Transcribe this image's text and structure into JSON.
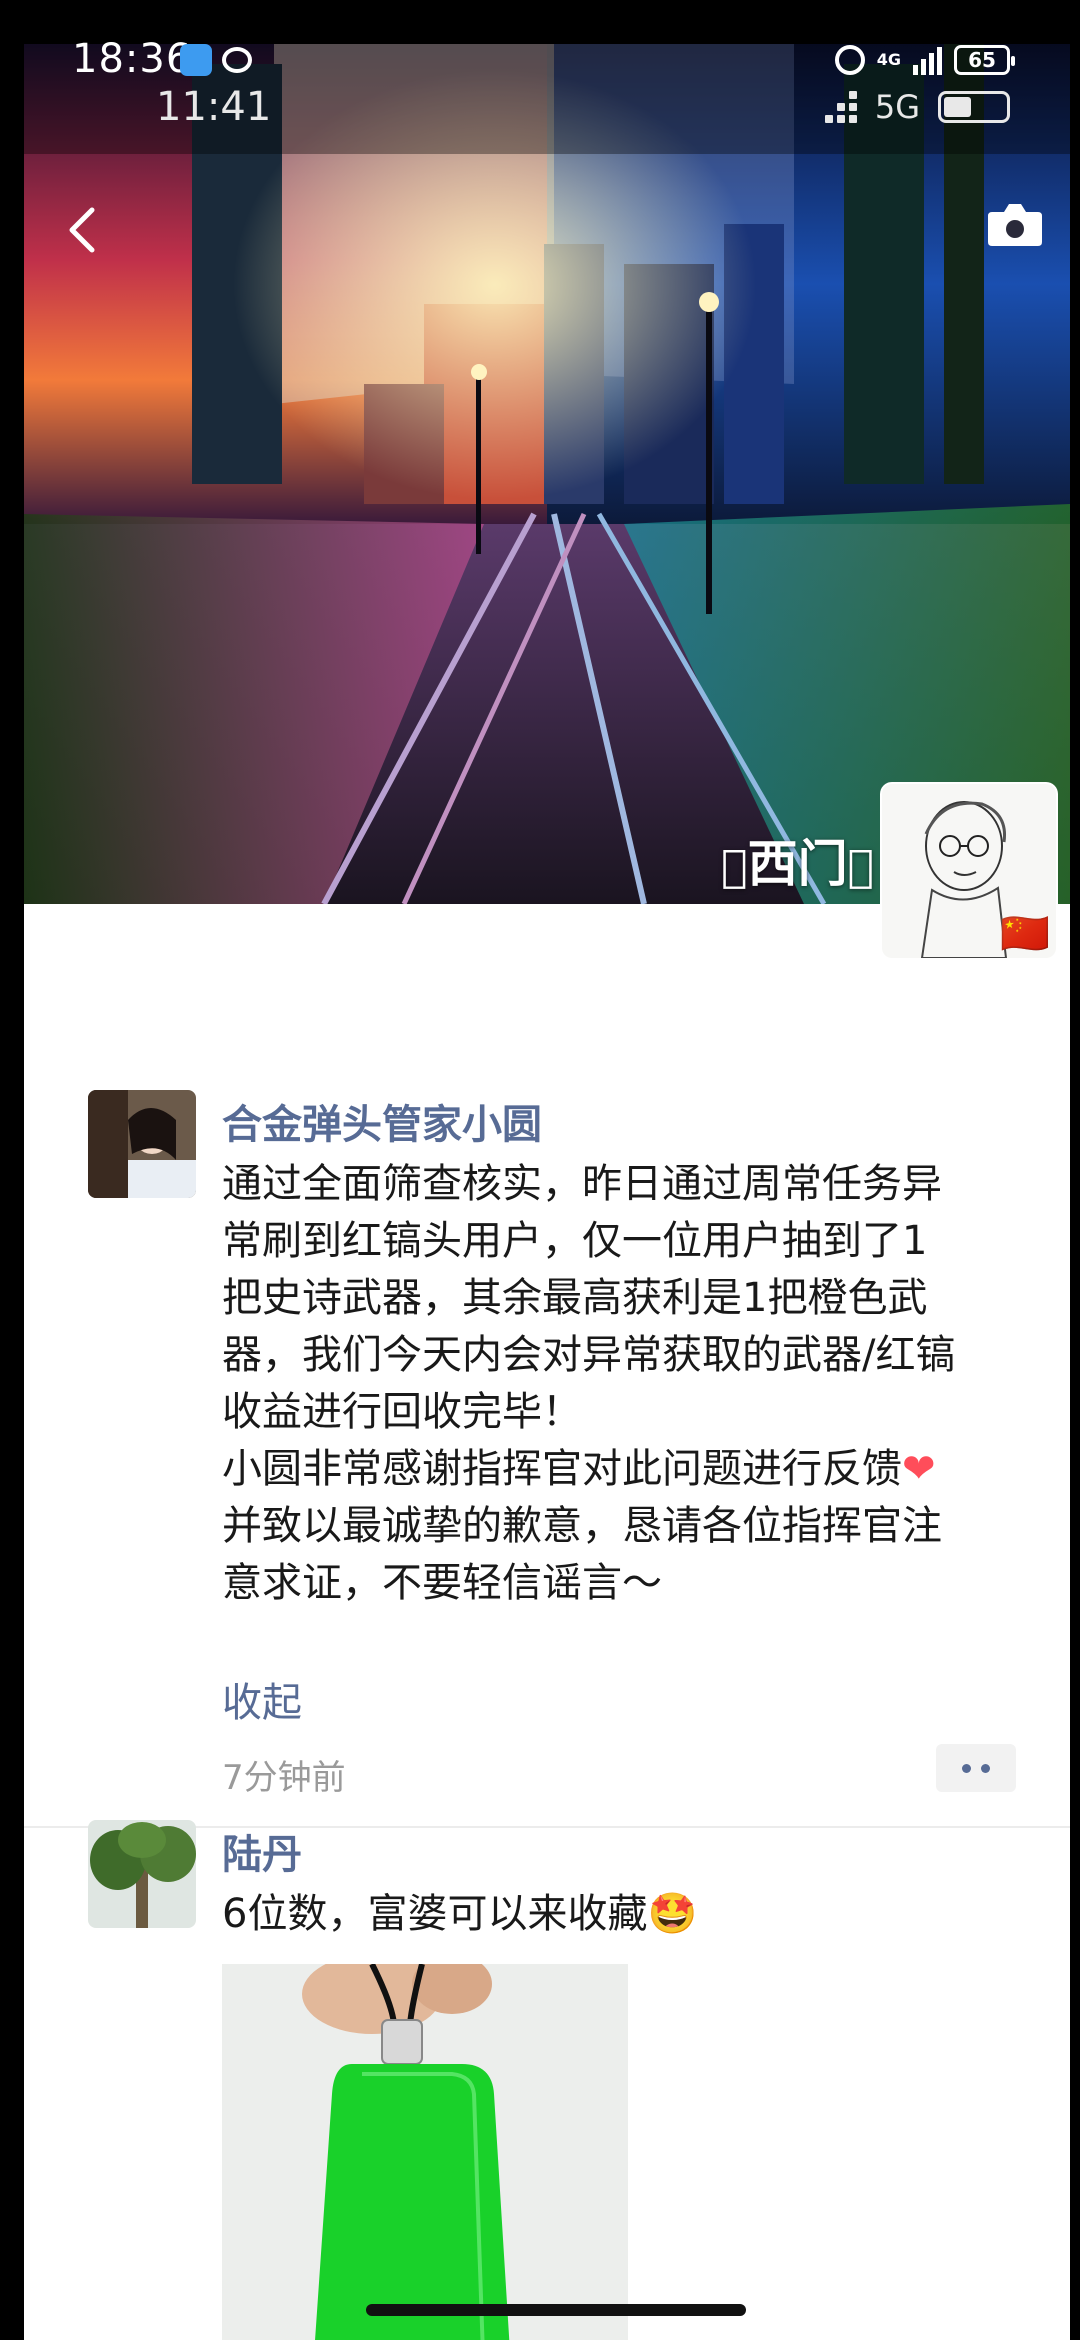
{
  "outer_status": {
    "time": "18:36",
    "net": "4G",
    "battery": "65"
  },
  "inner_status": {
    "time": "11:41",
    "network": "5G",
    "battery_level": 0.45
  },
  "profile": {
    "username": "西门",
    "flag": "🇨🇳"
  },
  "posts": [
    {
      "author": "合金弹头管家小圆",
      "lines": [
        "通过全面筛查核实，昨日通过周常任务异",
        "常刷到红镐头用户，仅一位用户抽到了1",
        "把史诗武器，其余最高获利是1把橙色武",
        "器，我们今天内会对异常获取的武器/红镐",
        "收益进行回收完毕！",
        "小圆非常感谢指挥官对此问题进行反馈",
        "并致以最诚挚的歉意，恳请各位指挥官注",
        "意求证，不要轻信谣言～"
      ],
      "heart": "❤",
      "collapse": "收起",
      "time": "7分钟前"
    },
    {
      "author": "陆丹",
      "text": "6位数，富婆可以来收藏",
      "emoji": "🤩"
    }
  ],
  "colors": {
    "link_blue": "#576b95",
    "time_gray": "#9a9a9a",
    "jade_green": "#19d12a"
  },
  "icons": [
    "back-chevron-icon",
    "camera-icon",
    "more-options-icon",
    "alarm-icon",
    "signal-icon",
    "battery-icon"
  ]
}
